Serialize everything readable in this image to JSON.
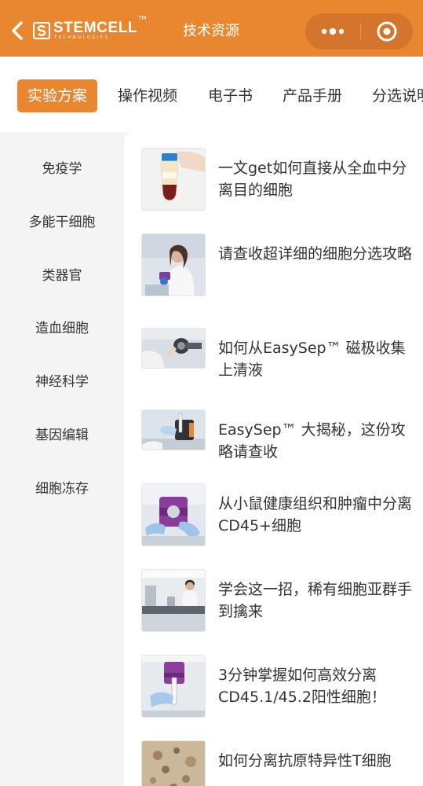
{
  "header": {
    "back_icon": "chevron-left-icon",
    "brand": "STEMCELL",
    "brand_tm": "TM",
    "brand_sub": "TECHNOLOGIES",
    "title": "技术资源",
    "more_icon": "more-dots-icon",
    "close_icon": "target-circle-icon",
    "background": "#e8872f"
  },
  "tabs": [
    {
      "label": "实验方案",
      "active": true
    },
    {
      "label": "操作视频",
      "active": false
    },
    {
      "label": "电子书",
      "active": false
    },
    {
      "label": "产品手册",
      "active": false
    },
    {
      "label": "分选说明",
      "active": false
    }
  ],
  "sidebar": {
    "items": [
      {
        "label": "免疫学"
      },
      {
        "label": "多能干细胞"
      },
      {
        "label": "类器官"
      },
      {
        "label": "造血细胞"
      },
      {
        "label": "神经科学"
      },
      {
        "label": "基因编辑"
      },
      {
        "label": "细胞冻存"
      }
    ]
  },
  "articles": [
    {
      "title": "一文get如何直接从全血中分离目的细胞"
    },
    {
      "title": "请查收超详细的细胞分选攻略"
    },
    {
      "title": "如何从EasySep™ 磁极收集上清液"
    },
    {
      "title": "EasySep™ 大揭秘，这份攻略请查收"
    },
    {
      "title": "从小鼠健康组织和肿瘤中分离CD45+细胞"
    },
    {
      "title": "学会这一招，稀有细胞亚群手到擒来"
    },
    {
      "title": "3分钟掌握如何高效分离CD45.1/45.2阳性细胞！"
    },
    {
      "title": "如何分离抗原特异性T细胞"
    }
  ]
}
